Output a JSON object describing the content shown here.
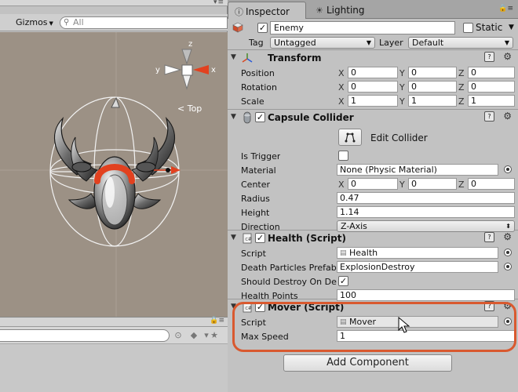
{
  "scene": {
    "gizmos_label": "Gizmos",
    "search_placeholder": "All",
    "orientation_label": "Top",
    "axis_labels": {
      "x": "x",
      "y": "y",
      "z": "z"
    }
  },
  "tabs": [
    {
      "label": "Inspector",
      "icon": "info-icon",
      "active": true
    },
    {
      "label": "Lighting",
      "icon": "lightbulb-icon",
      "active": false
    }
  ],
  "gameobject": {
    "active": true,
    "name": "Enemy",
    "static_label": "Static",
    "static_checked": false,
    "tag_label": "Tag",
    "tag_value": "Untagged",
    "layer_label": "Layer",
    "layer_value": "Default"
  },
  "transform": {
    "title": "Transform",
    "rows": [
      {
        "label": "Position",
        "x": "0",
        "y": "0",
        "z": "0"
      },
      {
        "label": "Rotation",
        "x": "0",
        "y": "0",
        "z": "0"
      },
      {
        "label": "Scale",
        "x": "1",
        "y": "1",
        "z": "1"
      }
    ],
    "axis": {
      "x": "X",
      "y": "Y",
      "z": "Z"
    }
  },
  "capsule_collider": {
    "title": "Capsule Collider",
    "enabled": true,
    "edit_label": "Edit Collider",
    "is_trigger_label": "Is Trigger",
    "is_trigger": false,
    "material_label": "Material",
    "material_value": "None (Physic Material)",
    "center_label": "Center",
    "center": {
      "x": "0",
      "y": "0",
      "z": "0"
    },
    "radius_label": "Radius",
    "radius": "0.47",
    "height_label": "Height",
    "height": "1.14",
    "direction_label": "Direction",
    "direction": "Z-Axis"
  },
  "health_script": {
    "title": "Health (Script)",
    "enabled": true,
    "script_label": "Script",
    "script_value": "Health",
    "particles_label": "Death Particles Prefab",
    "particles_value": "ExplosionDestroy",
    "destroy_label": "Should Destroy On Death",
    "destroy_checked": true,
    "hp_label": "Health Points",
    "hp_value": "100"
  },
  "mover_script": {
    "title": "Mover (Script)",
    "enabled": true,
    "script_label": "Script",
    "script_value": "Mover",
    "speed_label": "Max Speed",
    "speed_value": "1"
  },
  "add_component_label": "Add Component",
  "colors": {
    "accent_red": "#e04a2a",
    "highlight": "#d9592f",
    "viewport_bg": "#9c9185",
    "panel_bg": "#c2c2c2"
  }
}
